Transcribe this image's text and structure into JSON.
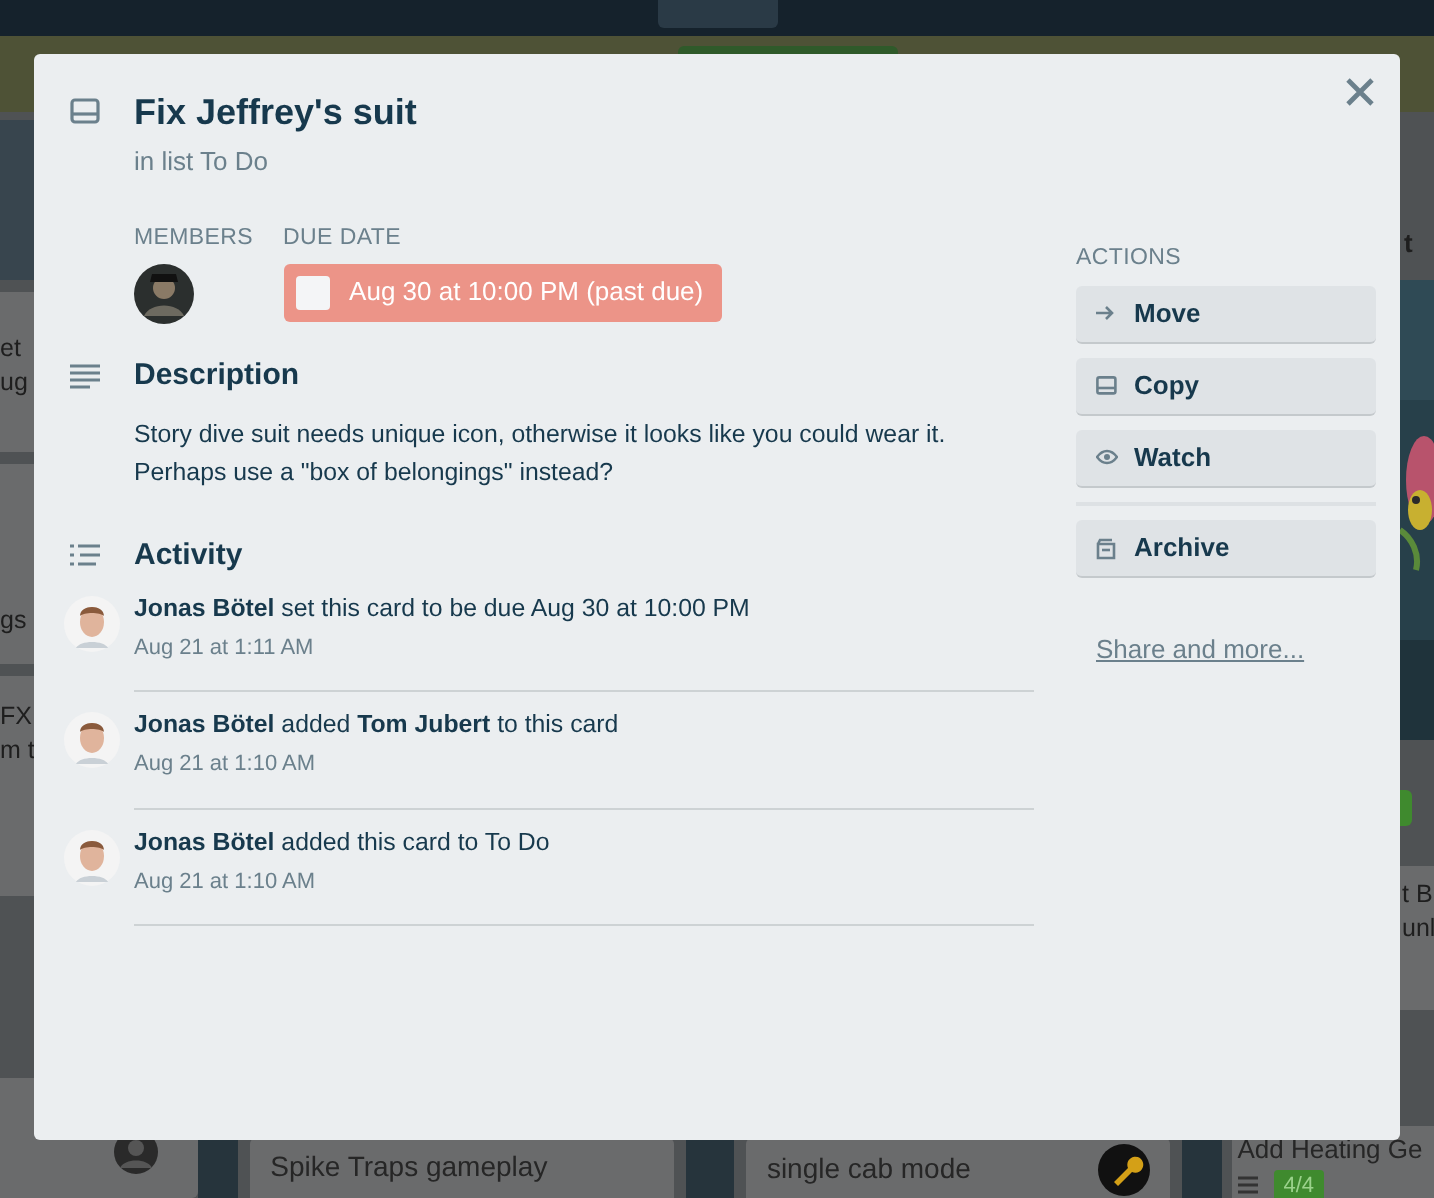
{
  "board": {
    "left_cards": [
      {
        "lines": [
          "et",
          "ug"
        ]
      },
      {
        "lines": [
          "gs"
        ]
      },
      {
        "lines": [
          "FX",
          "m t"
        ]
      }
    ],
    "right_list_title": "t",
    "right_cards": [
      {
        "lines": [
          "t B",
          "unl"
        ]
      }
    ],
    "bottom_cards": [
      {
        "title": "Spike Traps gameplay"
      },
      {
        "title": "single cab mode"
      },
      {
        "title": "Add Heating Ge",
        "checklist": "4/4"
      }
    ]
  },
  "card": {
    "title": "Fix Jeffrey's suit",
    "list_line": "in list To Do",
    "members_label": "MEMBERS",
    "due_label": "DUE DATE",
    "due": {
      "text": "Aug 30 at 10:00 PM (past due)",
      "complete": false,
      "past_due": true
    },
    "description_title": "Description",
    "description": "Story dive suit needs unique icon, otherwise it looks like you could wear it. Perhaps use a \"box of belongings\" instead?",
    "activity_title": "Activity",
    "activity": [
      {
        "text": "**Jonas Bötel** set this card to be due Aug 30 at 10:00 PM",
        "time": "Aug 21 at 1:11 AM"
      },
      {
        "text": "**Jonas Bötel** added **Tom Jubert** to this card",
        "time": "Aug 21 at 1:10 AM"
      },
      {
        "text": "**Jonas Bötel** added this card to To Do",
        "time": "Aug 21 at 1:10 AM"
      }
    ],
    "actions_label": "ACTIONS",
    "action_groups": [
      [
        {
          "kind": "move",
          "label": "Move"
        },
        {
          "kind": "copy",
          "label": "Copy"
        },
        {
          "kind": "watch",
          "label": "Watch"
        }
      ],
      [
        {
          "kind": "archive",
          "label": "Archive"
        }
      ]
    ],
    "share_link": "Share and more..."
  }
}
